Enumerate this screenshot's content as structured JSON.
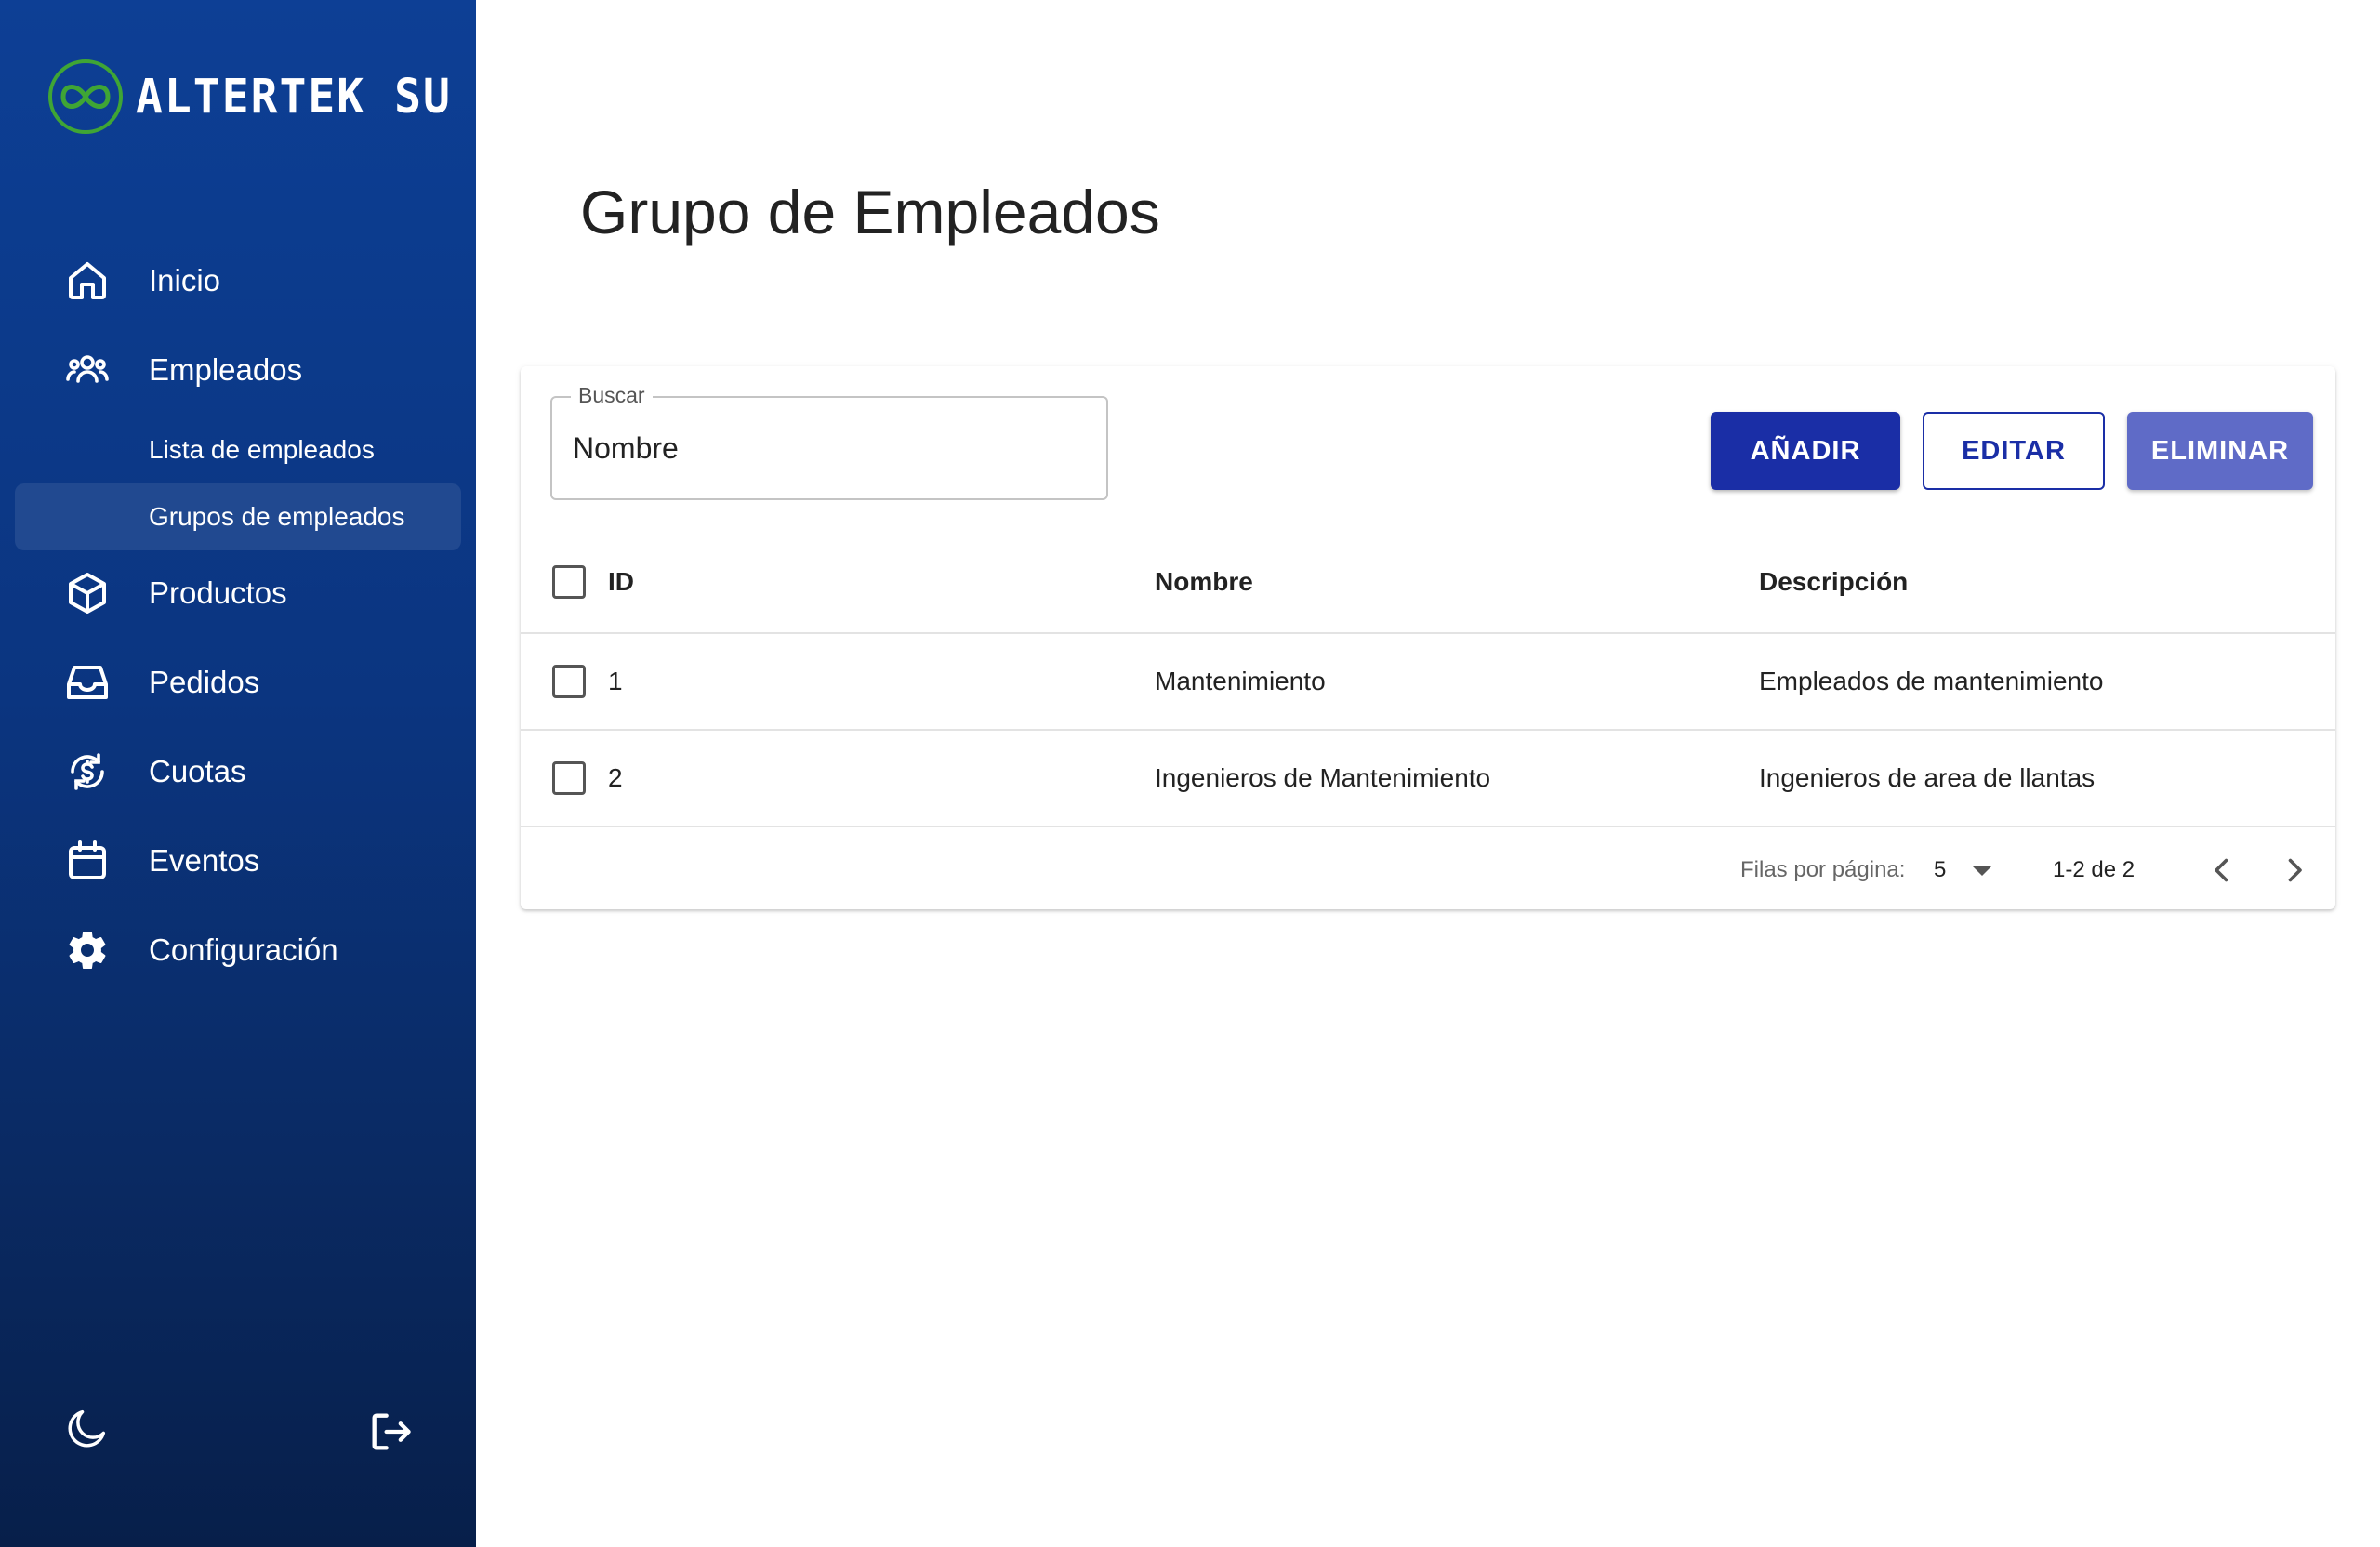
{
  "brand": {
    "name": "ALTERTEK SU",
    "logo_color": "#3fa535"
  },
  "sidebar": {
    "items": [
      {
        "label": "Inicio",
        "icon": "home-icon"
      },
      {
        "label": "Empleados",
        "icon": "users-icon"
      },
      {
        "label": "Productos",
        "icon": "box-icon"
      },
      {
        "label": "Pedidos",
        "icon": "inbox-icon"
      },
      {
        "label": "Cuotas",
        "icon": "dollar-cycle-icon"
      },
      {
        "label": "Eventos",
        "icon": "calendar-icon"
      },
      {
        "label": "Configuración",
        "icon": "gear-icon"
      }
    ],
    "subitems": [
      {
        "label": "Lista de empleados",
        "active": false
      },
      {
        "label": "Grupos de empleados",
        "active": true
      }
    ],
    "bottom": {
      "theme_icon": "moon-icon",
      "logout_icon": "logout-icon"
    }
  },
  "main": {
    "title": "Grupo de Empleados",
    "search": {
      "label": "Buscar",
      "value": "Nombre"
    },
    "buttons": {
      "add": "AÑADIR",
      "edit": "EDITAR",
      "delete": "ELIMINAR"
    },
    "table": {
      "columns": [
        "ID",
        "Nombre",
        "Descripción"
      ],
      "rows": [
        {
          "id": "1",
          "nombre": "Mantenimiento",
          "descripcion": "Empleados de mantenimiento"
        },
        {
          "id": "2",
          "nombre": "Ingenieros de Mantenimiento",
          "descripcion": "Ingenieros de area de llantas"
        }
      ]
    },
    "pagination": {
      "rows_label": "Filas por página:",
      "rows_value": "5",
      "range": "1-2 de 2"
    }
  },
  "colors": {
    "primary": "#1a2ea6",
    "primary_disabled": "#5f6bc7",
    "sidebar_top": "#0d3f95",
    "sidebar_bottom": "#071f4a"
  }
}
